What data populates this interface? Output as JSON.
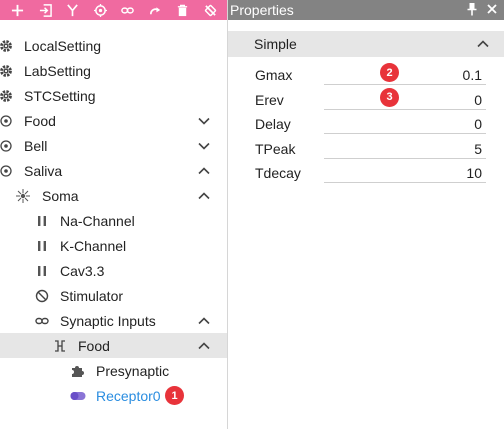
{
  "toolbar": {
    "buttons": [
      {
        "icon": "plus-icon"
      },
      {
        "icon": "import-icon"
      },
      {
        "icon": "branch-icon"
      },
      {
        "icon": "target-icon"
      },
      {
        "icon": "link-icon"
      },
      {
        "icon": "redo-icon"
      },
      {
        "icon": "trash-icon"
      },
      {
        "icon": "no-link-icon"
      }
    ],
    "color": "#f06aa0"
  },
  "tree": {
    "items": [
      {
        "label": "LocalSetting",
        "icon": "gear-icon"
      },
      {
        "label": "LabSetting",
        "icon": "gear-icon"
      },
      {
        "label": "STCSetting",
        "icon": "gear-icon"
      },
      {
        "label": "Food",
        "icon": "target-icon",
        "expanded": false
      },
      {
        "label": "Bell",
        "icon": "target-icon",
        "expanded": false
      },
      {
        "label": "Saliva",
        "icon": "target-icon",
        "expanded": true
      },
      {
        "label": "Soma",
        "icon": "soma-icon",
        "expanded": true
      },
      {
        "label": "Na-Channel",
        "icon": "pause-icon"
      },
      {
        "label": "K-Channel",
        "icon": "pause-icon"
      },
      {
        "label": "Cav3.3",
        "icon": "pause-icon"
      },
      {
        "label": "Stimulator",
        "icon": "ban-icon"
      },
      {
        "label": "Synaptic Inputs",
        "icon": "link-icon",
        "expanded": true
      },
      {
        "label": "Food",
        "icon": "synapse-icon",
        "expanded": true,
        "selected": true
      },
      {
        "label": "Presynaptic",
        "icon": "puzzle-icon"
      },
      {
        "label": "Receptor0",
        "icon": "toggle-icon",
        "link": true,
        "badge": "1"
      }
    ]
  },
  "properties": {
    "title": "Properties",
    "section": "Simple",
    "rows": [
      {
        "name": "Gmax",
        "value": "0.1",
        "badge": "2"
      },
      {
        "name": "Erev",
        "value": "0",
        "badge": "3"
      },
      {
        "name": "Delay",
        "value": "0"
      },
      {
        "name": "TPeak",
        "value": "5"
      },
      {
        "name": "Tdecay",
        "value": "10"
      }
    ]
  },
  "colors": {
    "accent": "#f06aa0",
    "header": "#838383",
    "badge": "#e8333a",
    "link": "#2a8de0",
    "toggle": "#6a4fc8"
  }
}
